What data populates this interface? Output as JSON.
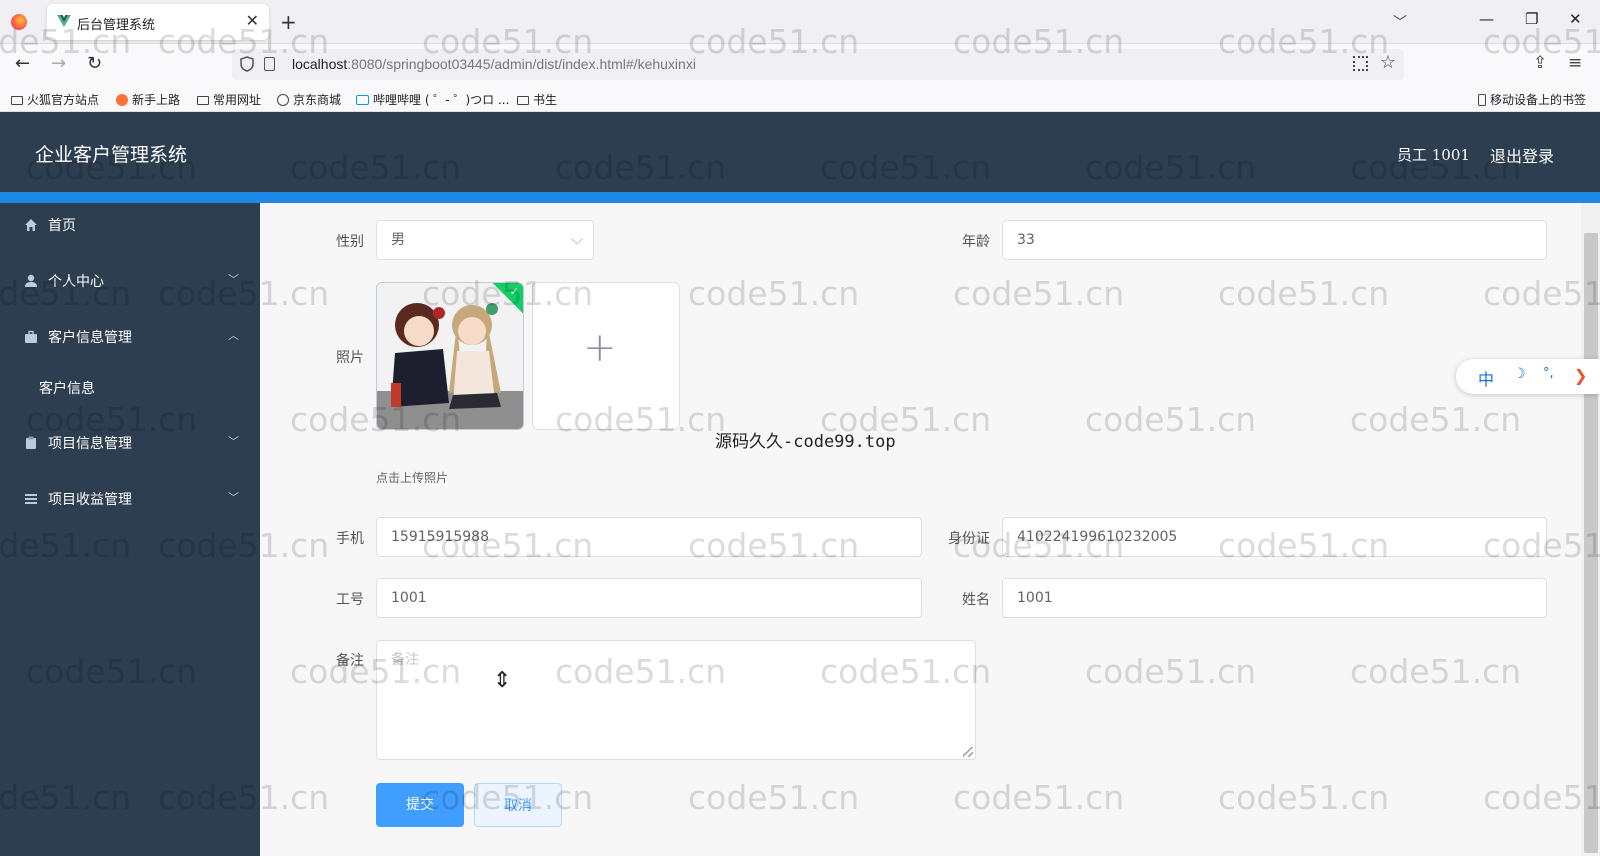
{
  "browser": {
    "tab_title": "后台管理系统",
    "url_host": "localhost",
    "url_rest": ":8080/springboot03445/admin/dist/index.html#/kehuxinxi",
    "bookmarks": [
      "火狐官方站点",
      "新手上路",
      "常用网址",
      "京东商城",
      "哔哩哔哩 ( ゜- ゜)つロ ...",
      "书生"
    ],
    "mobile_bookmarks": "移动设备上的书签"
  },
  "header": {
    "app_title": "企业客户管理系统",
    "user": "员工 1001",
    "logout": "退出登录"
  },
  "sidebar": {
    "items": [
      {
        "label": "首页",
        "icon": "home-icon"
      },
      {
        "label": "个人中心",
        "icon": "user-icon"
      },
      {
        "label": "客户信息管理",
        "icon": "briefcase-icon"
      },
      {
        "label": "项目信息管理",
        "icon": "clipboard-icon"
      },
      {
        "label": "项目收益管理",
        "icon": "list-icon"
      }
    ],
    "sub_items": [
      "客户信息"
    ]
  },
  "form": {
    "gender_label": "性别",
    "gender_value": "男",
    "age_label": "年龄",
    "age_value": "33",
    "photo_label": "照片",
    "upload_hint": "点击上传照片",
    "phone_label": "手机",
    "phone_value": "15915915988",
    "id_label": "身份证",
    "id_value": "410224199610232005",
    "workno_label": "工号",
    "workno_value": "1001",
    "name_label": "姓名",
    "name_value": "1001",
    "remark_label": "备注",
    "remark_placeholder": "备注",
    "submit": "提交",
    "cancel": "取消"
  },
  "ime": {
    "lang": "中",
    "moon": "☽",
    "punct": "°,",
    "arrow": "❯"
  },
  "overlay_text": "源码久久-code99.top",
  "watermark": "code51.cn",
  "colors": {
    "header": "#2c3e50",
    "accent": "#1e88e5",
    "primary": "#409eff"
  }
}
